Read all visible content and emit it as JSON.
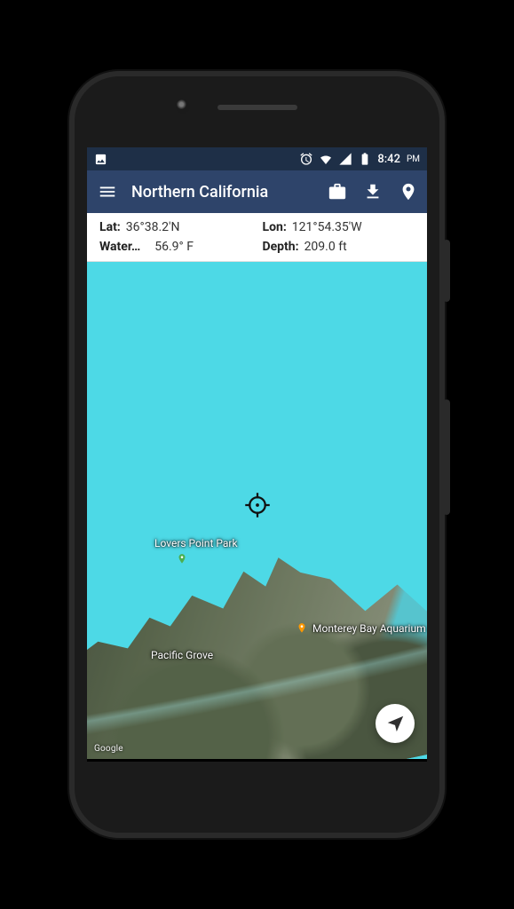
{
  "status": {
    "time": "8:42",
    "ampm": "PM"
  },
  "appbar": {
    "title": "Northern California"
  },
  "location": {
    "lat_label": "Lat:",
    "lat_value": "36°38.2'N",
    "lon_label": "Lon:",
    "lon_value": "121°54.35'W",
    "water_label": "Water…",
    "water_value": "56.9° F",
    "depth_label": "Depth:",
    "depth_value": "209.0 ft"
  },
  "map": {
    "attribution": "Google",
    "poi": {
      "lovers_point": "Lovers Point Park",
      "pacific_grove": "Pacific Grove",
      "mba": "Monterey Bay Aquarium"
    }
  }
}
